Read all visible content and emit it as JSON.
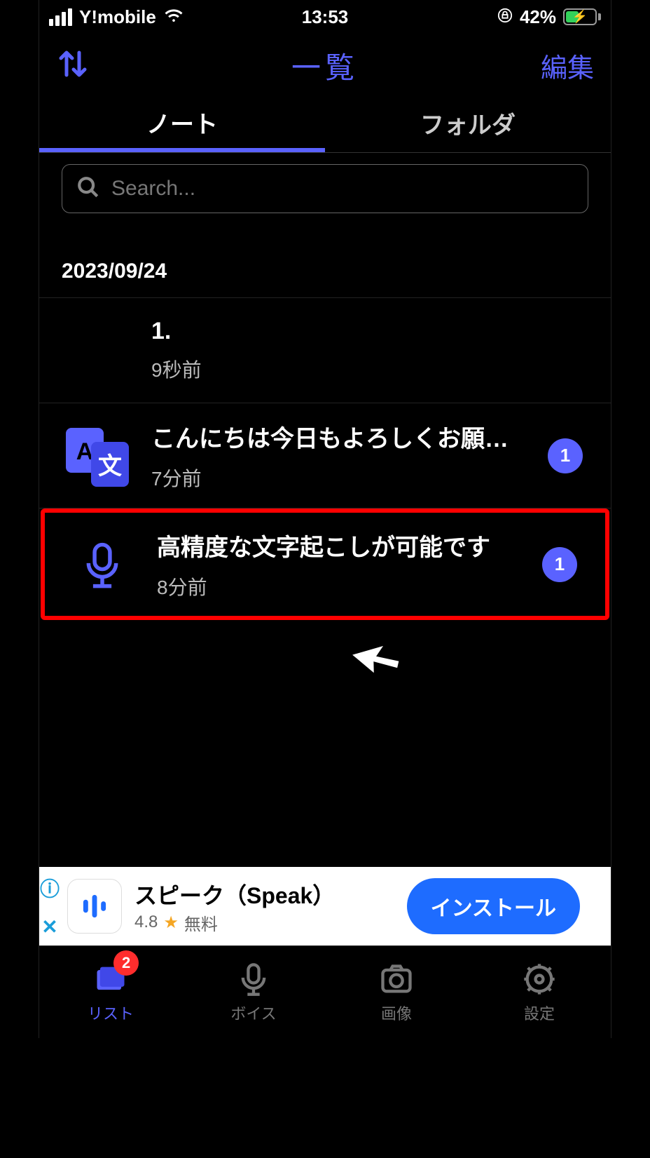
{
  "status": {
    "carrier": "Y!mobile",
    "time": "13:53",
    "battery_pct": "42%"
  },
  "nav": {
    "title": "一覧",
    "edit": "編集"
  },
  "tabs": {
    "notes": "ノート",
    "folders": "フォルダ"
  },
  "search": {
    "placeholder": "Search..."
  },
  "date_heading": "2023/09/24",
  "items": [
    {
      "title": "1.",
      "sub": "9秒前"
    },
    {
      "title": "こんにちは今日もよろしくお願い…",
      "sub": "7分前",
      "badge": "1",
      "icon": "translate"
    },
    {
      "title": "高精度な文字起こしが可能です",
      "sub": "8分前",
      "badge": "1",
      "icon": "mic",
      "highlighted": true
    }
  ],
  "ad": {
    "title": "スピーク（Speak）",
    "rating": "4.8",
    "price": "無料",
    "cta": "インストール"
  },
  "tabbar": {
    "list": {
      "label": "リスト",
      "badge": "2"
    },
    "voice": {
      "label": "ボイス"
    },
    "image": {
      "label": "画像"
    },
    "settings": {
      "label": "設定"
    }
  }
}
